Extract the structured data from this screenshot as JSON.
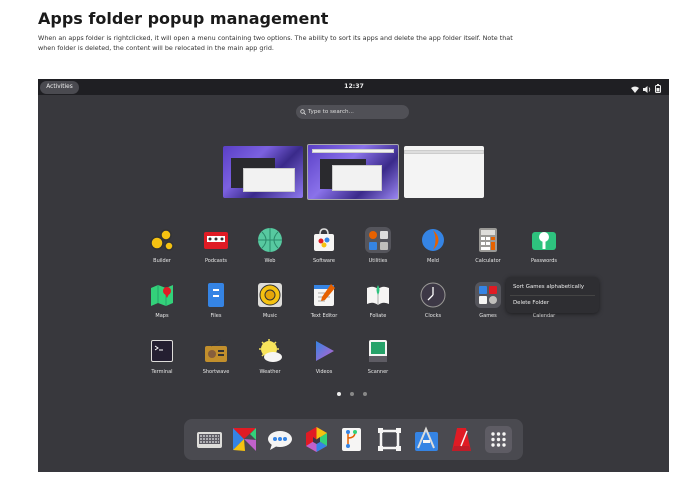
{
  "doc": {
    "title": "Apps folder popup management",
    "description": "When an apps folder is rightclicked, it will open a menu containing two options. The ability to sort its apps and delete the app folder itself. Note that when folder is deleted, the content will be relocated in the main app grid."
  },
  "topbar": {
    "activities": "Activities",
    "clock": "12:37"
  },
  "search": {
    "placeholder": "Type to search..."
  },
  "apps": [
    {
      "label": "Builder",
      "icon": "builder-icon"
    },
    {
      "label": "Podcasts",
      "icon": "podcasts-icon"
    },
    {
      "label": "Web",
      "icon": "web-icon"
    },
    {
      "label": "Software",
      "icon": "software-icon"
    },
    {
      "label": "Utilities",
      "icon": "utilities-folder-icon"
    },
    {
      "label": "Meld",
      "icon": "meld-icon"
    },
    {
      "label": "Calculator",
      "icon": "calculator-icon"
    },
    {
      "label": "Passwords",
      "icon": "passwords-icon"
    },
    {
      "label": "Maps",
      "icon": "maps-icon"
    },
    {
      "label": "Files",
      "icon": "files-icon"
    },
    {
      "label": "Music",
      "icon": "music-icon"
    },
    {
      "label": "Text Editor",
      "icon": "text-editor-icon"
    },
    {
      "label": "Foliate",
      "icon": "foliate-icon"
    },
    {
      "label": "Clocks",
      "icon": "clocks-icon"
    },
    {
      "label": "Games",
      "icon": "games-folder-icon"
    },
    {
      "label": "Calendar",
      "icon": "calendar-icon"
    },
    {
      "label": "Terminal",
      "icon": "terminal-icon"
    },
    {
      "label": "Shortwave",
      "icon": "shortwave-icon"
    },
    {
      "label": "Weather",
      "icon": "weather-icon"
    },
    {
      "label": "Videos",
      "icon": "videos-icon"
    },
    {
      "label": "Scanner",
      "icon": "scanner-icon"
    }
  ],
  "context_menu": {
    "items": [
      "Sort Games alphabetically",
      "Delete Folder"
    ]
  },
  "pagination": {
    "pages": 3,
    "current": 1
  },
  "dash": [
    {
      "icon": "keyboard-icon"
    },
    {
      "icon": "tangram-icon"
    },
    {
      "icon": "chat-icon"
    },
    {
      "icon": "color-picker-icon"
    },
    {
      "icon": "git-icon"
    },
    {
      "icon": "frame-icon"
    },
    {
      "icon": "science-icon"
    },
    {
      "icon": "metronome-icon"
    },
    {
      "icon": "app-grid-icon"
    }
  ]
}
